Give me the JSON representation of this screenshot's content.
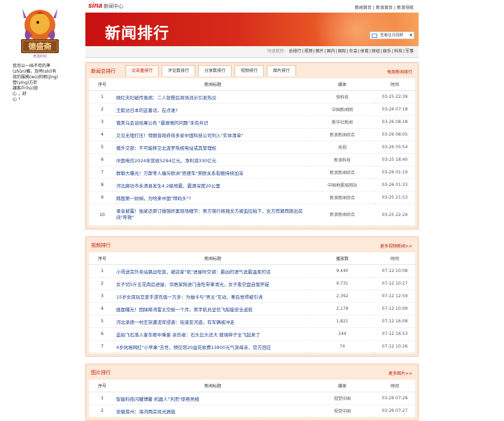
{
  "sidebar": {
    "logo_text": "德盛斋",
    "logo_sub": "老酒封坛",
    "lines": [
      "我司以一絲不苟的準",
      "(zhǔn)備，及時(shí)有",
      "效的服務(wù)的眀(jīng)",
      "營(yíng)方針",
      "讓客戶(hù)放",
      "心          ，舒",
      "心      ！"
    ]
  },
  "header": {
    "brand": "sina",
    "brand_sub": "新闻中心",
    "links": [
      "新闻首页",
      "|",
      "新浪首页",
      "|",
      "新浪导航"
    ],
    "banner_title": "新闻排行",
    "date_select": "查看往日回顾",
    "quicknav_label": "快速跳转:",
    "quicknav": [
      "总排行",
      "视频",
      "图片",
      "国内",
      "国际",
      "社会",
      "体育",
      "财经",
      "娱乐",
      "科技",
      "军事"
    ]
  },
  "news": {
    "title": "新闻总排行",
    "more": "每周新闻排行",
    "tabs": [
      "点击量排行",
      "评论数排行",
      "分享数排行",
      "视频排行",
      "图片排行"
    ],
    "columns": [
      "序号",
      "新闻标题",
      "媒体",
      "时间"
    ],
    "rows": [
      {
        "n": "1",
        "title": "网红夫妇被传患病：二人就餐后商场消示引发热议",
        "media": "快科技",
        "time": "03-25 22:39"
      },
      {
        "n": "2",
        "title": "王毅访日本的这番话，在点谁?",
        "media": "中国新闻网",
        "time": "03-26 07:18"
      },
      {
        "n": "3",
        "title": "俄美乌会谈结果公布 \"最艰难的问题\"未有共识",
        "media": "新华社新闻",
        "time": "03-26 08:18"
      },
      {
        "n": "4",
        "title": "又见无理打压！特朗普政府将多家中国科技公司列入\"实体清单\"",
        "media": "新浪新闻综合",
        "time": "03-26 08:05"
      },
      {
        "n": "5",
        "title": "俄外交部：不可能移交北波罗热核电站或其管理权",
        "media": "央视",
        "time": "03-26 05:54"
      },
      {
        "n": "6",
        "title": "中国电信2024年营收5294亿元，净利润330亿元",
        "media": "新浪科技",
        "time": "03-25 18:40"
      },
      {
        "n": "7",
        "title": "群聊大曝光！万斯等人痛斥欧洲\"搭便车\"美欧关系裂痕持续加深",
        "media": "新浪新闻综合",
        "time": "03-26 01:19"
      },
      {
        "n": "8",
        "title": "河北廊坊市永清县发生4.2级地震，震源深度20公里",
        "media": "中国地震局网站",
        "time": "03-26 01:33"
      },
      {
        "n": "9",
        "title": "韩国第一财阀，为啥来中国\"拜码头\"?",
        "media": "新浪新闻综合",
        "time": "03-25 21:53"
      },
      {
        "n": "10",
        "title": "录音披露！独家还原订婚强奸案现场细节：男方强行拖拽女方被监控拍下，女方慌窘而跑出房间\"呼救\"",
        "media": "新浪新闻综合",
        "time": "03-25 22:24"
      }
    ]
  },
  "video": {
    "title": "视频排行",
    "more": "更多视频新闻>>",
    "columns": [
      "序号",
      "新闻标题",
      "播放数",
      "时间"
    ],
    "rows": [
      {
        "n": "1",
        "title": "小哥送完外卖站路边吃饭，被店家\"吼\"进屋吹空调：最凶的语气说最温柔的话",
        "media": "9,440",
        "time": "07-12 10:08"
      },
      {
        "n": "2",
        "title": "女子切5斤五花肉后进屋，邻居家狗进门连吃带拿清光，女子看空盘自我怀疑",
        "media": "4,731",
        "time": "07-12 10:27"
      },
      {
        "n": "3",
        "title": "15岁女孩玩恋爱手游充值一万多：为抽卡与\"男主\"互动，事后觉得被引诱",
        "media": "2,392",
        "time": "07-12 12:59"
      },
      {
        "n": "4",
        "title": "画面曝光！因陕降湾雷太空舱一个月，美宇航员坚信飞船能安全返航",
        "media": "2,178",
        "time": "07-12 10:09"
      },
      {
        "n": "5",
        "title": "河北承德一村庄突遭泥浆侵袭：街道变河道，有车辆被冲走",
        "media": "1,821",
        "time": "07-12 16:08"
      },
      {
        "n": "6",
        "title": "监拍飞石落入客车砸中乘客 亲历者：石头比头还大 玻璃碎子全飞起来了",
        "media": "244",
        "time": "07-12 16:53"
      },
      {
        "n": "7",
        "title": "4岁抗癌网红\"小苹果\"去世，预仅馆20益花收费13800元气哭母亲，官方回应",
        "media": "74",
        "time": "07-12 10:26"
      }
    ]
  },
  "pictures": {
    "title": "图片排行",
    "more": "更多图片>>",
    "columns": [
      "序号",
      "新闻标题",
      "媒体",
      "时间"
    ],
    "rows": [
      {
        "n": "1",
        "title": "智能科技闪耀博鳌 机器人\"天团\"惊艳亮相",
        "media": "视觉中国",
        "time": "03-26 07:28"
      },
      {
        "n": "2",
        "title": "安徽滁州：海河两岸风光旖旎",
        "media": "视觉中国",
        "time": "03-26 07:27"
      }
    ]
  }
}
